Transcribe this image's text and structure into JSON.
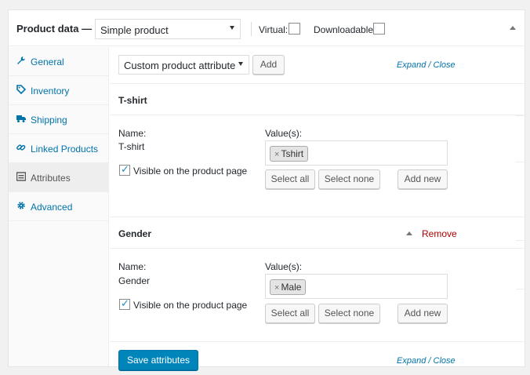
{
  "header": {
    "title": "Product data —",
    "product_type": "Simple product",
    "virtual_label": "Virtual:",
    "downloadable_label": "Downloadable:"
  },
  "sidebar": {
    "items": [
      {
        "label": "General",
        "icon": "wrench-icon"
      },
      {
        "label": "Inventory",
        "icon": "tag-icon"
      },
      {
        "label": "Shipping",
        "icon": "truck-icon"
      },
      {
        "label": "Linked Products",
        "icon": "link-icon"
      },
      {
        "label": "Attributes",
        "icon": "list-icon",
        "active": true
      },
      {
        "label": "Advanced",
        "icon": "gear-icon"
      }
    ]
  },
  "toolbar": {
    "attribute_select": "Custom product attribute",
    "add_label": "Add",
    "expand_label": "Expand",
    "close_label": "Close",
    "separator": "/"
  },
  "attributes": [
    {
      "title": "T-shirt",
      "name_label": "Name:",
      "name_value": "T-shirt",
      "values_label": "Value(s):",
      "value_chip": "Tshirt",
      "visible_label": "Visible on the product page",
      "visible_checked": true,
      "select_all": "Select all",
      "select_none": "Select none",
      "add_new": "Add new"
    },
    {
      "title": "Gender",
      "remove_label": "Remove",
      "name_label": "Name:",
      "name_value": "Gender",
      "values_label": "Value(s):",
      "value_chip": "Male",
      "visible_label": "Visible on the product page",
      "visible_checked": true,
      "select_all": "Select all",
      "select_none": "Select none",
      "add_new": "Add new"
    }
  ],
  "footer": {
    "save_label": "Save attributes",
    "expand_label": "Expand",
    "close_label": "Close",
    "separator": "/"
  },
  "colors": {
    "link": "#0073aa",
    "primary_button": "#0085ba",
    "remove": "#aa0000"
  }
}
